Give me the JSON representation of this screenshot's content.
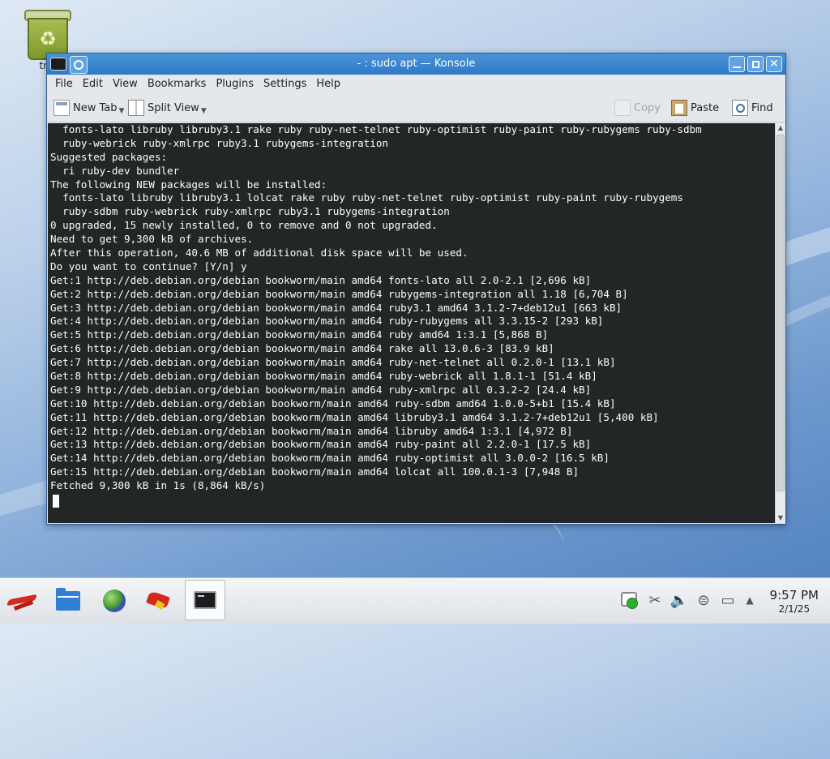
{
  "desktop": {
    "icons": [
      {
        "label": "tra",
        "icon": "trash-icon"
      }
    ]
  },
  "window": {
    "title": "- : sudo apt — Konsole",
    "menu": [
      "File",
      "Edit",
      "View",
      "Bookmarks",
      "Plugins",
      "Settings",
      "Help"
    ],
    "toolbar": {
      "new_tab": "New Tab",
      "split_view": "Split View",
      "copy": "Copy",
      "paste": "Paste",
      "find": "Find"
    },
    "terminal": {
      "lines": [
        "  fonts-lato libruby libruby3.1 rake ruby ruby-net-telnet ruby-optimist ruby-paint ruby-rubygems ruby-sdbm",
        "  ruby-webrick ruby-xmlrpc ruby3.1 rubygems-integration",
        "Suggested packages:",
        "  ri ruby-dev bundler",
        "The following NEW packages will be installed:",
        "  fonts-lato libruby libruby3.1 lolcat rake ruby ruby-net-telnet ruby-optimist ruby-paint ruby-rubygems",
        "  ruby-sdbm ruby-webrick ruby-xmlrpc ruby3.1 rubygems-integration",
        "0 upgraded, 15 newly installed, 0 to remove and 0 not upgraded.",
        "Need to get 9,300 kB of archives.",
        "After this operation, 40.6 MB of additional disk space will be used.",
        "Do you want to continue? [Y/n] y",
        "Get:1 http://deb.debian.org/debian bookworm/main amd64 fonts-lato all 2.0-2.1 [2,696 kB]",
        "Get:2 http://deb.debian.org/debian bookworm/main amd64 rubygems-integration all 1.18 [6,704 B]",
        "Get:3 http://deb.debian.org/debian bookworm/main amd64 ruby3.1 amd64 3.1.2-7+deb12u1 [663 kB]",
        "Get:4 http://deb.debian.org/debian bookworm/main amd64 ruby-rubygems all 3.3.15-2 [293 kB]",
        "Get:5 http://deb.debian.org/debian bookworm/main amd64 ruby amd64 1:3.1 [5,868 B]",
        "Get:6 http://deb.debian.org/debian bookworm/main amd64 rake all 13.0.6-3 [83.9 kB]",
        "Get:7 http://deb.debian.org/debian bookworm/main amd64 ruby-net-telnet all 0.2.0-1 [13.1 kB]",
        "Get:8 http://deb.debian.org/debian bookworm/main amd64 ruby-webrick all 1.8.1-1 [51.4 kB]",
        "Get:9 http://deb.debian.org/debian bookworm/main amd64 ruby-xmlrpc all 0.3.2-2 [24.4 kB]",
        "Get:10 http://deb.debian.org/debian bookworm/main amd64 ruby-sdbm amd64 1.0.0-5+b1 [15.4 kB]",
        "Get:11 http://deb.debian.org/debian bookworm/main amd64 libruby3.1 amd64 3.1.2-7+deb12u1 [5,400 kB]",
        "Get:12 http://deb.debian.org/debian bookworm/main amd64 libruby amd64 1:3.1 [4,972 B]",
        "Get:13 http://deb.debian.org/debian bookworm/main amd64 ruby-paint all 2.2.0-1 [17.5 kB]",
        "Get:14 http://deb.debian.org/debian bookworm/main amd64 ruby-optimist all 3.0.0-2 [16.5 kB]",
        "Get:15 http://deb.debian.org/debian bookworm/main amd64 lolcat all 100.0.1-3 [7,948 B]",
        "Fetched 9,300 kB in 1s (8,864 kB/s)"
      ]
    }
  },
  "taskbar": {
    "launchers": [
      "application-menu-icon",
      "file-manager-icon",
      "web-browser-icon",
      "firefox-icon",
      "konsole-icon"
    ],
    "tray": [
      "update-notifier-icon",
      "clipboard-icon",
      "volume-icon",
      "network-icon",
      "display-icon",
      "tray-expand-icon"
    ],
    "clock": {
      "time": "9:57 PM",
      "date": "2/1/25"
    }
  },
  "colors": {
    "titlebar": "#3a86d0",
    "terminal_bg": "#232627",
    "terminal_fg": "#fcfcfc"
  }
}
